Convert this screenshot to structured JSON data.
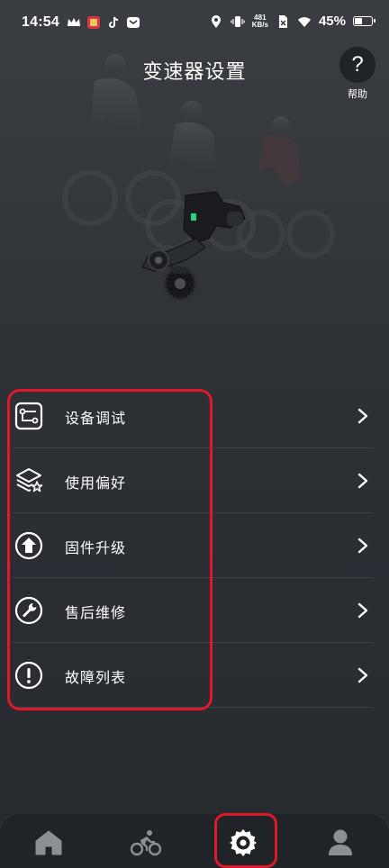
{
  "status_bar": {
    "time": "14:54",
    "netspeed_value": "481",
    "netspeed_unit": "KB/s",
    "battery_percent": "45%",
    "battery_level": 0.45,
    "left_icons": [
      "crown-icon",
      "app-badge-icon",
      "tiktok-icon",
      "mail-icon"
    ],
    "right_icons": [
      "location-icon",
      "vibrate-icon",
      "no-sim-icon",
      "wifi-icon",
      "battery-icon"
    ]
  },
  "header": {
    "title": "变速器设置",
    "help_label": "帮助",
    "help_icon_text": "?"
  },
  "menu": {
    "items": [
      {
        "label": "设备调试",
        "icon": "device-debug-icon"
      },
      {
        "label": "使用偏好",
        "icon": "preferences-layers-icon"
      },
      {
        "label": "固件升级",
        "icon": "firmware-upgrade-icon"
      },
      {
        "label": "售后维修",
        "icon": "wrench-icon"
      },
      {
        "label": "故障列表",
        "icon": "exclamation-icon"
      }
    ]
  },
  "bottom_nav": {
    "items": [
      "home-icon",
      "cycling-icon",
      "settings-gear-icon",
      "profile-icon"
    ],
    "active": "settings-gear-icon"
  },
  "colors": {
    "accent_highlight": "#e0182a",
    "background": "#2b2f34",
    "nav_background": "#202328",
    "active_icon": "#ffffff",
    "inactive_icon": "#8c9096"
  }
}
